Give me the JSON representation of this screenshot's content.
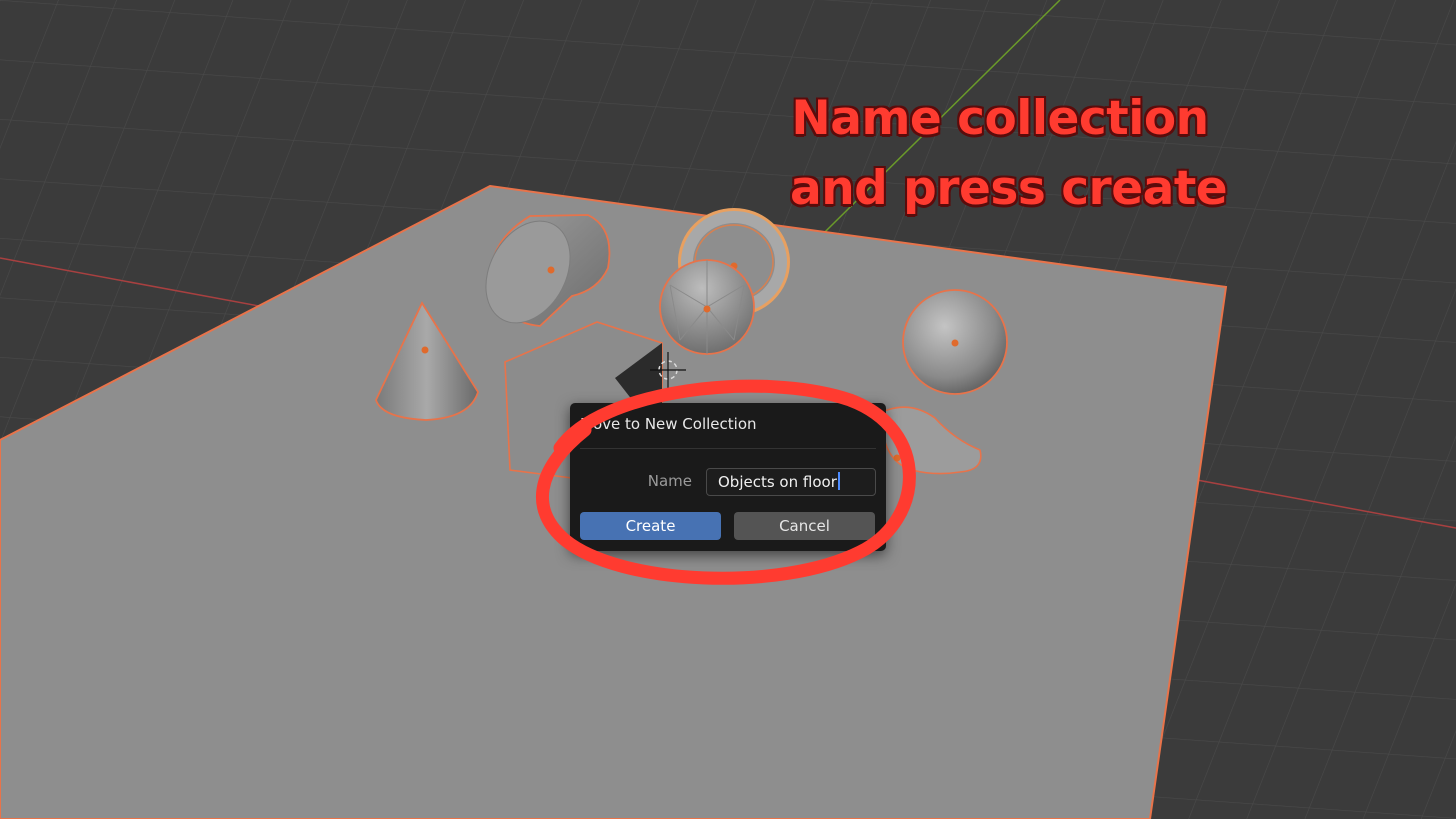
{
  "annotation": {
    "line1": "Name collection",
    "line2": "and press create",
    "color": "#ff3b30"
  },
  "dialog": {
    "title": "Move to New Collection",
    "name_label": "Name",
    "name_value": "Objects on floor",
    "create_label": "Create",
    "cancel_label": "Cancel",
    "create_color": "#4772b3",
    "cancel_color": "#545454"
  },
  "viewport": {
    "background_color": "#3b3b3b",
    "floor_color": "#8e8e8e",
    "selection_outline_color": "#e8734a",
    "x_axis_color": "#b04040",
    "y_axis_color": "#6a9a2a",
    "objects": [
      "plane-floor",
      "cylinder",
      "cone",
      "cube",
      "torus",
      "icosphere",
      "uv-sphere",
      "monkey"
    ]
  }
}
